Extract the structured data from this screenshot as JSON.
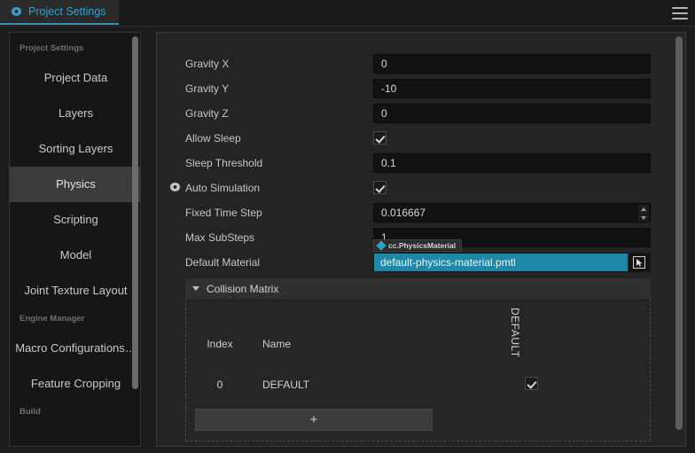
{
  "window": {
    "tab_label": "Project Settings",
    "tab_icon": "gear-icon",
    "menu_icon": "hamburger-menu-icon",
    "accent_color": "#3a9fd0"
  },
  "sidebar": {
    "groups": [
      {
        "title": "Project Settings",
        "items": [
          {
            "label": "Project Data",
            "active": false
          },
          {
            "label": "Layers",
            "active": false
          },
          {
            "label": "Sorting Layers",
            "active": false
          },
          {
            "label": "Physics",
            "active": true
          },
          {
            "label": "Scripting",
            "active": false
          },
          {
            "label": "Model",
            "active": false
          },
          {
            "label": "Joint Texture Layout",
            "active": false
          }
        ]
      },
      {
        "title": "Engine Manager",
        "items": [
          {
            "label": "Macro Configurations…",
            "active": false
          },
          {
            "label": "Feature Cropping",
            "active": false
          }
        ]
      },
      {
        "title": "Build",
        "items": []
      }
    ]
  },
  "form": {
    "rows": [
      {
        "label": "Gravity X",
        "type": "text",
        "value": "0"
      },
      {
        "label": "Gravity Y",
        "type": "text",
        "value": "-10"
      },
      {
        "label": "Gravity Z",
        "type": "text",
        "value": "0"
      },
      {
        "label": "Allow Sleep",
        "type": "checkbox",
        "value": true
      },
      {
        "label": "Sleep Threshold",
        "type": "text",
        "value": "0.1"
      },
      {
        "label": "Auto Simulation",
        "type": "checkbox",
        "value": true,
        "icon": "gear-icon"
      },
      {
        "label": "Fixed Time Step",
        "type": "spinner",
        "value": "0.016667"
      },
      {
        "label": "Max SubSteps",
        "type": "text",
        "value": "1"
      },
      {
        "label": "Default Material",
        "type": "asset",
        "value": "default-physics-material.pmtl"
      }
    ],
    "asset_tooltip": {
      "text": "cc.PhysicsMaterial",
      "icon": "diamond-icon"
    },
    "asset_highlight_color": "#1d88a8",
    "asset_picker_icon": "cursor-picker-icon"
  },
  "collision_matrix": {
    "title": "Collision Matrix",
    "expand_icon": "chevron-down-icon",
    "columns": [
      "Index",
      "Name"
    ],
    "matrix_columns": [
      "DEFAULT"
    ],
    "rows": [
      {
        "index": "0",
        "name": "DEFAULT",
        "checks": [
          true
        ]
      }
    ],
    "add_button_label": "+"
  }
}
